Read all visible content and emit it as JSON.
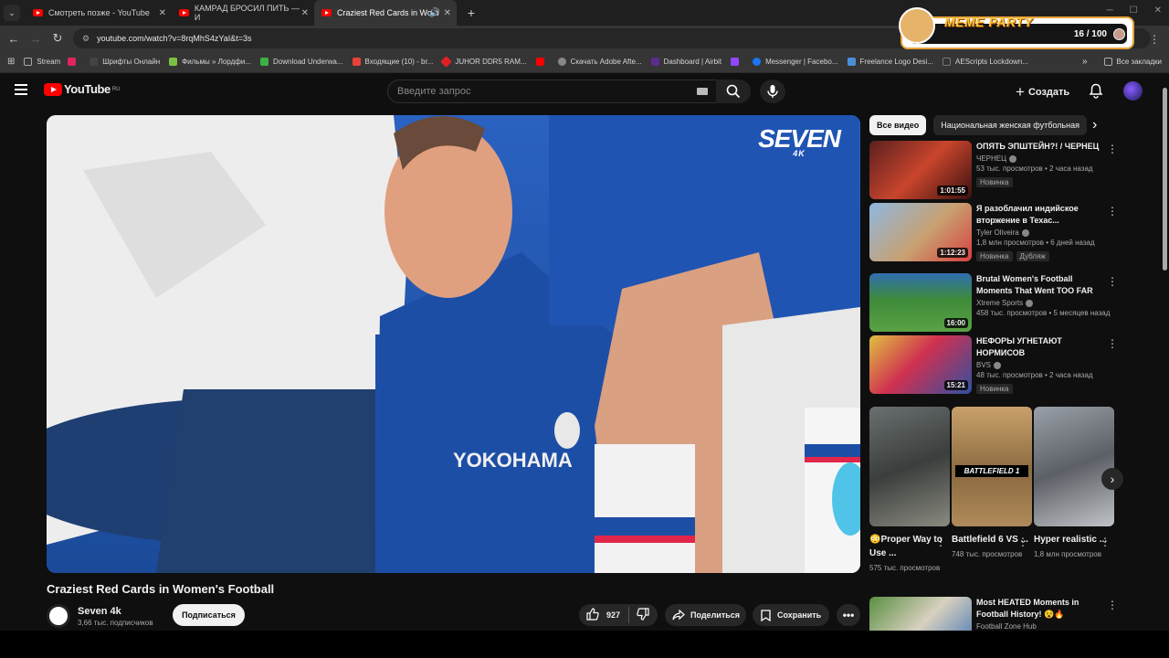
{
  "browser": {
    "tabs": [
      {
        "title": "Смотреть позже - YouTube"
      },
      {
        "title": "КАМРАД БРОСИЛ ПИТЬ — И"
      },
      {
        "title": "Craziest Red Cards in Wom"
      }
    ],
    "url": "youtube.com/watch?v=8rqMhS4zYaI&t=3s",
    "bookmarks": [
      "Stream",
      "Шрифты Онлайн",
      "Фильмы » Лордфи...",
      "Download Underwa...",
      "Входящие (10) - br...",
      "JUHOR DDR5 RAM...",
      "Скачать Adobe Afte...",
      "Dashboard | Airbit",
      "Messenger | Facebo...",
      "Freelance Logo Desi...",
      "AEScripts Lockdown..."
    ],
    "all_bookmarks": "Все закладки"
  },
  "meme_party": {
    "title": "MEME PARTY",
    "progress": "16 / 100"
  },
  "youtube": {
    "logo": "YouTube",
    "region": "RU",
    "search_placeholder": "Введите запрос",
    "create_label": "Создать"
  },
  "video": {
    "title": "Craziest Red Cards in Women's Football",
    "channel": "Seven 4k",
    "subscribers": "3,66 тыс. подписчиков",
    "subscribe_label": "Подписаться",
    "likes": "927",
    "share_label": "Поделиться",
    "save_label": "Сохранить",
    "watermark": "SEVEN",
    "watermark_sub": "4K"
  },
  "chips": [
    "Все видео",
    "Национальная женская футбольная"
  ],
  "recommendations": [
    {
      "title": "ОПЯТЬ ЭПШТЕЙН?! / ЧЕРНЕЦ",
      "channel": "ЧЕРНЕЦ",
      "meta": "53 тыс. просмотров • 2 часа назад",
      "badge": "Новинка",
      "duration": "1:01:55"
    },
    {
      "title": "Я разоблачил индийское вторжение в Техас...",
      "channel": "Tyler Oliveira",
      "meta": "1,8 млн просмотров • 6 дней назад",
      "badge": "Новинка",
      "badge2": "Дубляж",
      "duration": "1:12:23"
    },
    {
      "title": "Brutal Women's Football Moments That Went TOO FAR",
      "channel": "Xtreme Sports",
      "meta": "458 тыс. просмотров • 5 месяцев назад",
      "duration": "16:00"
    },
    {
      "title": "НЕФОРЫ УГНЕТАЮТ НОРМИСОВ",
      "channel": "BVS",
      "meta": "48 тыс. просмотров • 2 часа назад",
      "badge": "Новинка",
      "duration": "15:21"
    }
  ],
  "shorts": [
    {
      "title": "😳Proper Way to Use ...",
      "views": "575 тыс. просмотров"
    },
    {
      "title": "Battlefield 6 VS ...",
      "views": "748 тыс. просмотров",
      "overlay": "BATTLEFIELD 1"
    },
    {
      "title": "Hyper realistic ...",
      "views": "1,8 млн просмотров"
    }
  ],
  "last_rec": {
    "title": "Most HEATED Moments in Football History! 😵🔥",
    "channel": "Football Zone Hub"
  }
}
